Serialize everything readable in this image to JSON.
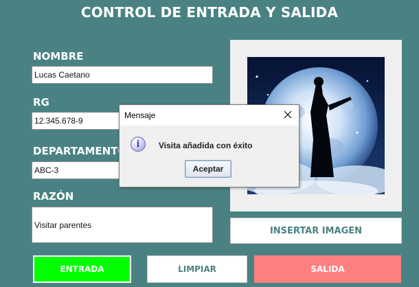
{
  "window": {
    "title": "CONTROL DE ENTRADA Y SALIDA"
  },
  "form": {
    "nombre": {
      "label": "NOMBRE",
      "value": "Lucas Caetano"
    },
    "rg": {
      "label": "RG",
      "value": "12.345.678-9"
    },
    "departamento": {
      "label": "DEPARTAMENTO",
      "value": "ABC-3"
    },
    "razon": {
      "label": "RAZÓN",
      "value": "Visitar parentes"
    }
  },
  "image_panel": {
    "insert_label": "INSERTAR IMAGEN",
    "image_icon": "anime-moon-silhouette-image"
  },
  "buttons": {
    "entrada": "ENTRADA",
    "limpiar": "LIMPIAR",
    "salida": "SALIDA"
  },
  "dialog": {
    "title": "Mensaje",
    "message": "Visita añadida con éxito",
    "ok_label": "Aceptar",
    "icon": "info-icon",
    "close_icon": "close-icon"
  },
  "colors": {
    "background": "#4a8283",
    "entrada": "#00ff00",
    "salida": "#ff8080",
    "accent_text": "#4a8283"
  }
}
